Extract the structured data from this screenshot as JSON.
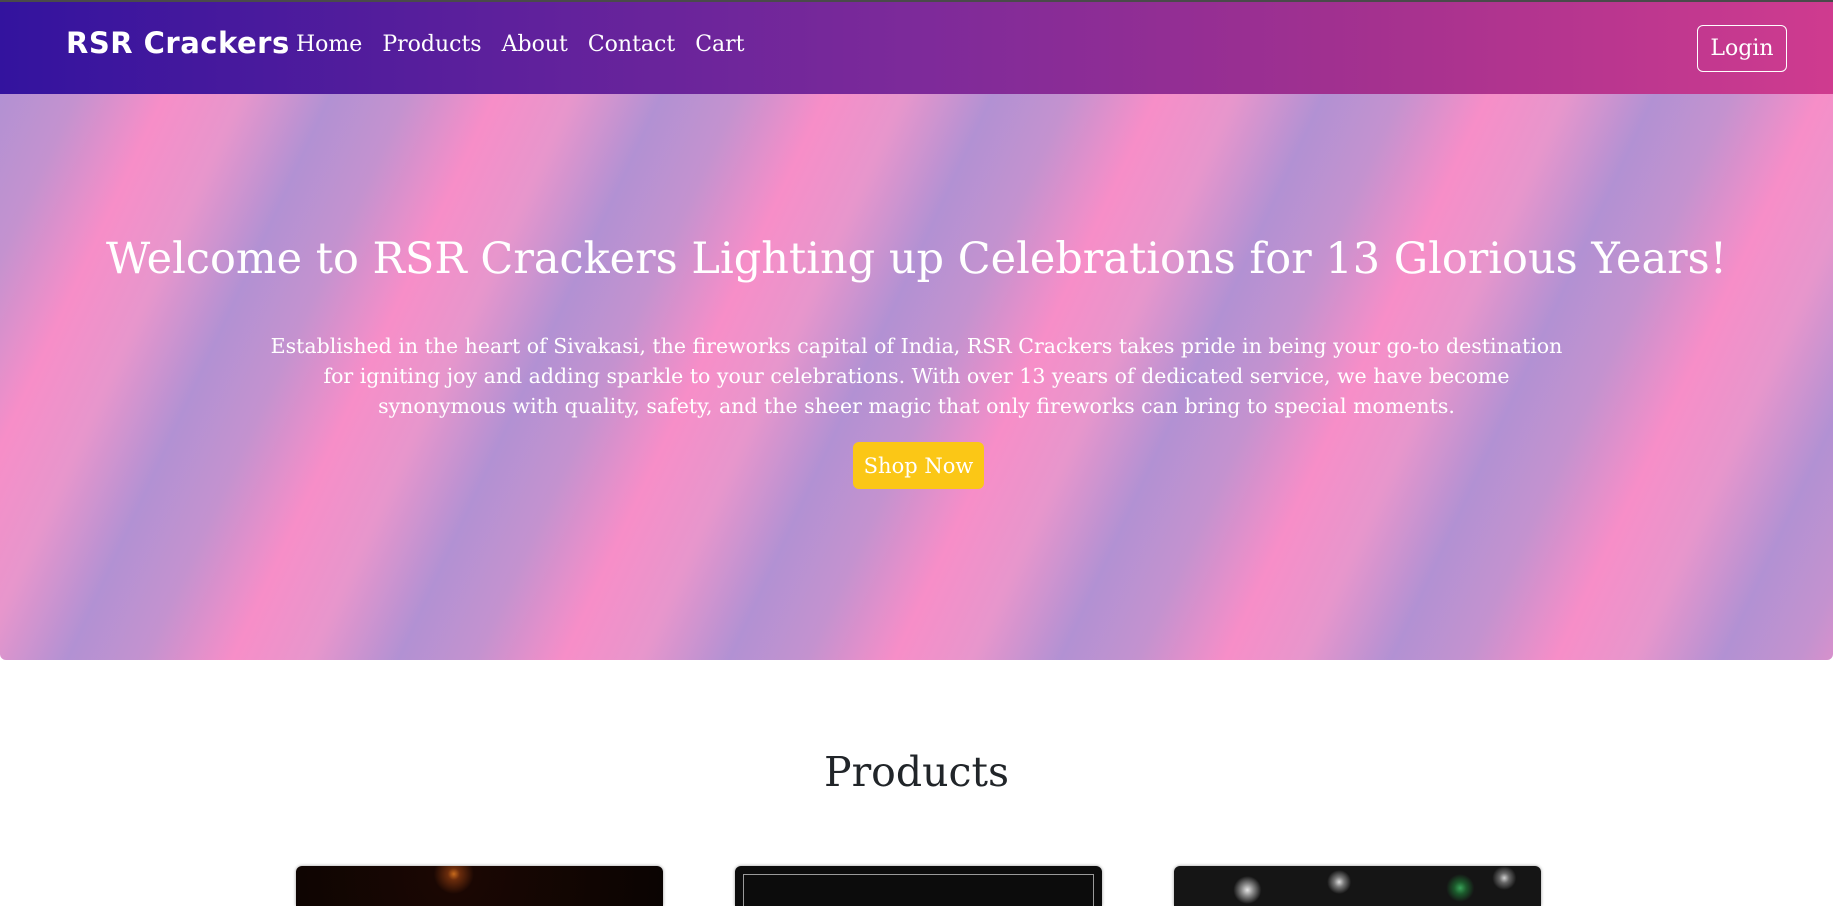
{
  "nav": {
    "brand": "RSR Crackers",
    "links": [
      "Home",
      "Products",
      "About",
      "Contact",
      "Cart"
    ],
    "login_label": "Login"
  },
  "hero": {
    "title": "Welcome to RSR Crackers Lighting up Celebrations for 13 Glorious Years!",
    "description": "Established in the heart of Sivakasi, the fireworks capital of India, RSR Crackers takes pride in being your go-to destination for igniting joy and adding sparkle to your celebrations. With over 13 years of dedicated service, we have become synonymous with quality, safety, and the sheer magic that only fireworks can bring to special moments.",
    "cta_label": "Shop Now"
  },
  "products": {
    "heading": "Products"
  },
  "colors": {
    "nav_start": "#33139e",
    "nav_end": "#cf3b8f",
    "hero_pink": "#f78ec8",
    "hero_lavender": "#b291d3",
    "cta": "#fbc716"
  }
}
